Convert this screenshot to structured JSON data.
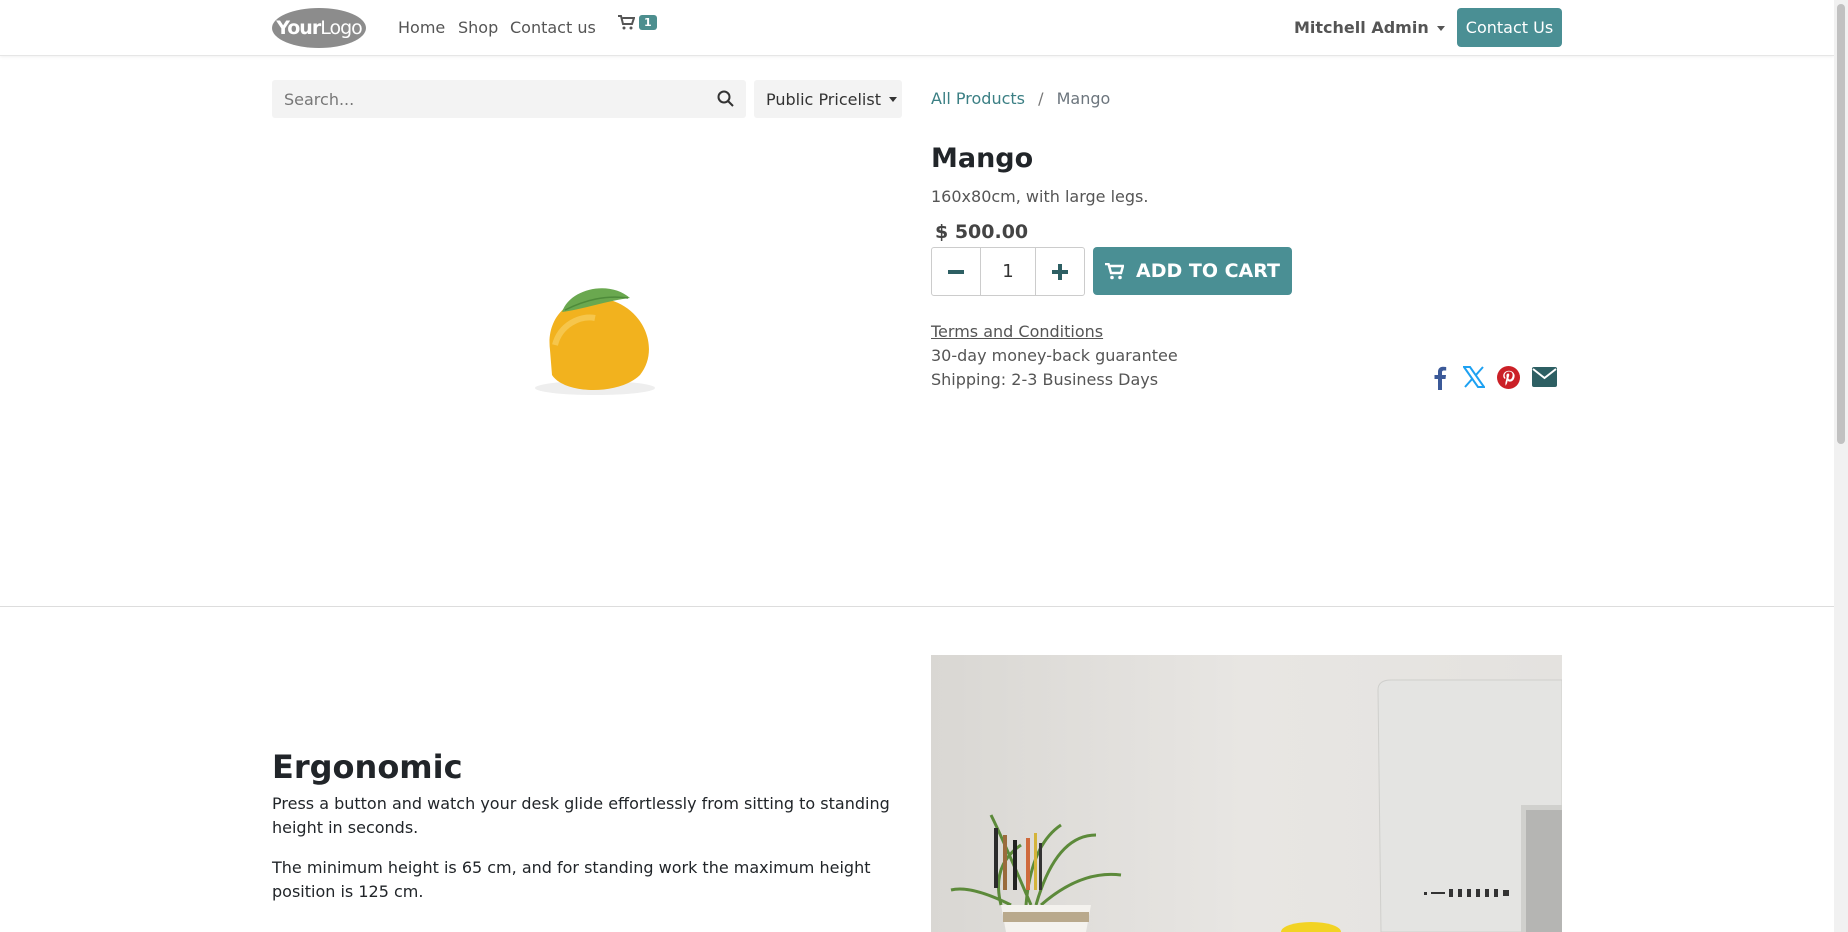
{
  "nav": {
    "logo": {
      "bold": "Your",
      "light": "Logo"
    },
    "links": [
      "Home",
      "Shop",
      "Contact us"
    ],
    "cart_count": "1",
    "user": "Mitchell Admin",
    "contact_button": "Contact Us"
  },
  "search": {
    "placeholder": "Search..."
  },
  "pricelist": "Public Pricelist",
  "breadcrumb": {
    "parent": "All Products",
    "separator": "/",
    "current": "Mango"
  },
  "product": {
    "name": "Mango",
    "description": "160x80cm, with large legs.",
    "price": "$ 500.00",
    "quantity": "1",
    "add_to_cart": "ADD TO CART",
    "terms": "Terms and Conditions",
    "guarantee": "30-day money-back guarantee",
    "shipping": "Shipping: 2-3 Business Days"
  },
  "share_icons": [
    "facebook-icon",
    "x-icon",
    "pinterest-icon",
    "email-icon"
  ],
  "feature": {
    "title": "Ergonomic",
    "p1": "Press a button and watch your desk glide effortlessly from sitting to standing height in seconds.",
    "p2": "The minimum height is 65 cm, and for standing work the maximum height position is 125 cm."
  },
  "colors": {
    "accent": "#4a8f94",
    "link": "#3b7f84",
    "corner": "#714b67"
  }
}
